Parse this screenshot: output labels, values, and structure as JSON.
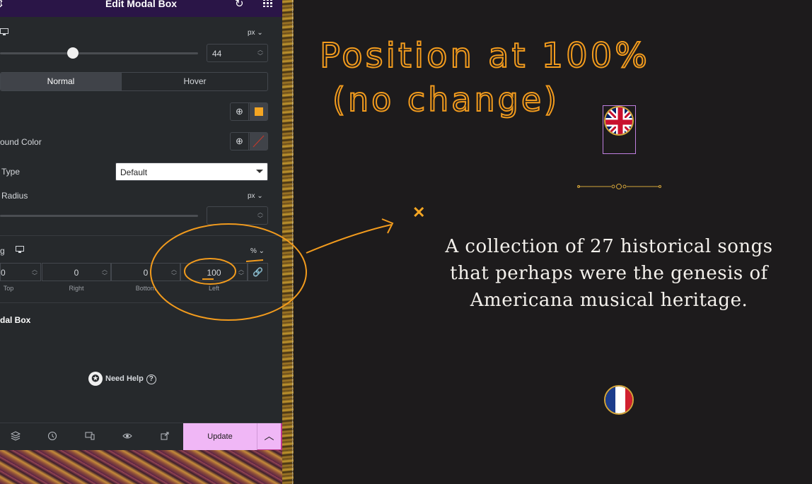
{
  "header": {
    "title": "Edit Modal Box"
  },
  "size_control": {
    "unit": "px",
    "value": "44",
    "slider_fraction": 0.36
  },
  "state_tabs": [
    {
      "label": "Normal",
      "active": true
    },
    {
      "label": "Hover",
      "active": false
    }
  ],
  "colors": {
    "accent": "#f5a623",
    "panel_bg": "#26292c",
    "header_bg": "#2a1547",
    "update_bg": "#f0b7f6",
    "background_color_clear": "#c0392b"
  },
  "background_color": {
    "label": "ound Color"
  },
  "border_type": {
    "label": "Type",
    "value": "Default"
  },
  "border_radius": {
    "label": "Radius",
    "unit": "px",
    "value": ""
  },
  "padding": {
    "label": "g",
    "unit": "%",
    "fields": [
      {
        "value": "0",
        "label": "Top"
      },
      {
        "value": "0",
        "label": "Right"
      },
      {
        "value": "0",
        "label": "Bottom"
      },
      {
        "value": "100",
        "label": "Left"
      }
    ]
  },
  "section": {
    "title": "dal Box"
  },
  "help": {
    "label": "Need Help"
  },
  "footer": {
    "update_label": "Update"
  },
  "annotation": {
    "line1": "Position at 100%",
    "line2": "(no change)"
  },
  "content": {
    "text": "A collection of 27 historical songs that perhaps were the genesis of Americana musical heritage."
  }
}
